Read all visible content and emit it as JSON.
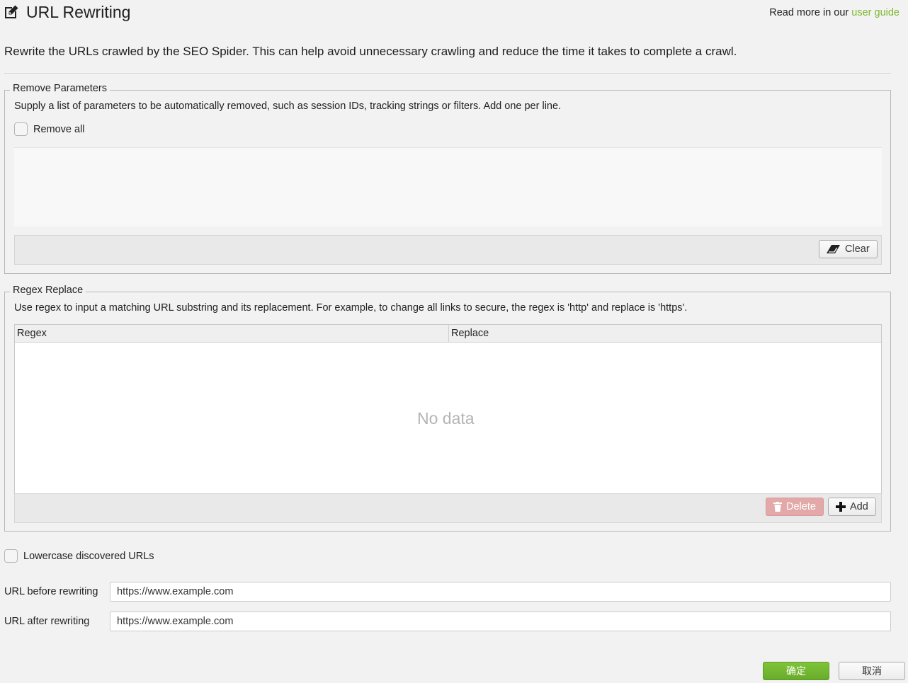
{
  "header": {
    "title": "URL Rewriting",
    "read_more_prefix": "Read more in our ",
    "read_more_link": "user guide",
    "intro": "Rewrite the URLs crawled by the SEO Spider. This can help avoid unnecessary crawling and reduce the time it takes to complete a crawl."
  },
  "remove_parameters": {
    "legend": "Remove Parameters",
    "help": "Supply a list of parameters to be automatically removed, such as session IDs, tracking strings or filters. Add one per line.",
    "remove_all_label": "Remove all",
    "remove_all_checked": false,
    "parameters_text": "",
    "clear_label": "Clear"
  },
  "regex_replace": {
    "legend": "Regex Replace",
    "help": "Use regex to input a matching URL substring and its replacement. For example, to change all links to secure, the regex is 'http' and replace is 'https'.",
    "columns": [
      "Regex",
      "Replace"
    ],
    "rows": [],
    "empty_text": "No data",
    "delete_label": "Delete",
    "add_label": "Add"
  },
  "lowercase": {
    "label": "Lowercase discovered URLs",
    "checked": false
  },
  "test": {
    "before_label": "URL before rewriting",
    "before_value": "https://www.example.com",
    "after_label": "URL after rewriting",
    "after_value": "https://www.example.com"
  },
  "footer": {
    "ok_label": "确定",
    "cancel_label": "取消"
  },
  "colors": {
    "accent": "#7cb82f",
    "delete_disabled": "#e3a9a9"
  }
}
